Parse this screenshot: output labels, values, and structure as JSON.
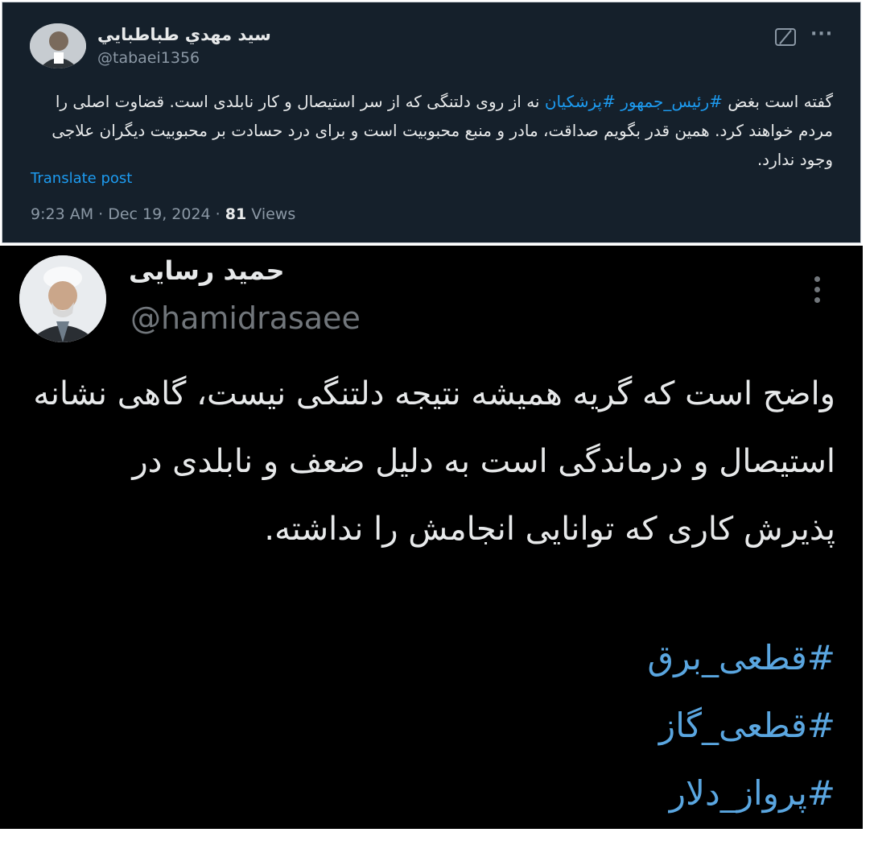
{
  "tweet1": {
    "author_name": "سيد مهدي طباطبايي",
    "handle": "@tabaei1356",
    "body_prefix": "گفته است بغض ",
    "hashtag_1": "#رئیس_جمهور",
    "hashtag_2": "#پزشکیان",
    "body_rest": " نه از روی دلتنگی که از سر استیصال و کار نابلدی است. قضاوت اصلی را مردم خواهند کرد. همین قدر بگویم صداقت، مادر و منبع محبوبیت است و برای درد حسادت بر محبوبیت دیگران علاجی وجود ندارد.",
    "translate_label": "Translate post",
    "time": "9:23 AM · Dec 19, 2024 · ",
    "views_count": "81",
    "views_label": " Views",
    "icons": [
      "grok-icon",
      "more-horizontal-icon"
    ],
    "colors": {
      "background": "#15202b",
      "link": "#1d9bf0",
      "text": "#e7e9ea",
      "muted": "#8b98a5"
    }
  },
  "tweet2": {
    "author_name": "حمید رسایی",
    "handle": "@hamidrasaee",
    "body": "واضح است که گریه همیشه نتیجه دلتنگی نیست، گاهی نشانه استیصال و درماندگی است به دلیل ضعف و نابلدی در پذیرش کاری که توانایی انجامش را نداشته.",
    "hashtags": [
      "#قطعی_برق",
      "#قطعی_گاز",
      "#پرواز_دلار"
    ],
    "icons": [
      "more-vertical-icon"
    ],
    "colors": {
      "background": "#000000",
      "link": "#5aa6e0",
      "text": "#e7e9ea",
      "muted": "#71767b"
    }
  }
}
